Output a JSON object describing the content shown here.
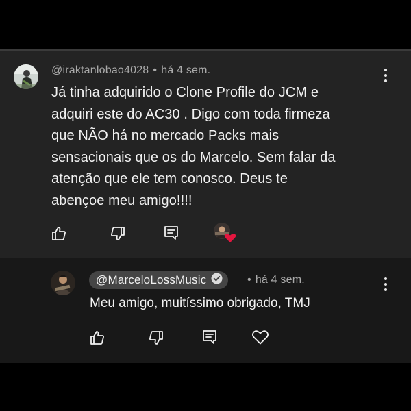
{
  "comment": {
    "author": "@iraktanlobao4028",
    "separator": "•",
    "time": "há 4 sem.",
    "text": "Já tinha adquirido o Clone Profile do JCM e\nadquiri este do AC30 . Digo com toda firmeza\nque NÃO há no mercado Packs mais\nsensacionais que os do Marcelo.  Sem falar da\natenção que ele tem conosco.  Deus te\nabençoe meu amigo!!!!",
    "actions": [
      "like-icon",
      "dislike-icon",
      "reply-icon",
      "creator-heart-badge"
    ],
    "menu": "more-options-icon"
  },
  "reply": {
    "author": "@MarceloLossMusic",
    "verified": "verified-check-icon",
    "separator": "•",
    "time": "há 4 sem.",
    "text": "Meu amigo, muitíssimo obrigado, TMJ",
    "actions": [
      "like-icon",
      "dislike-icon",
      "reply-icon",
      "heart-icon"
    ],
    "menu": "more-options-icon"
  },
  "colors": {
    "background": "#000000",
    "comment_bg": "#232323",
    "reply_bg": "#181818",
    "text": "#f1f1f1",
    "meta": "#aaaaaa",
    "heart": "#e3163f",
    "pill": "#454545"
  }
}
